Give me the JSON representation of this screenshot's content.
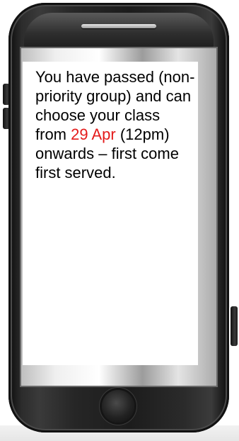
{
  "message": {
    "part1": "You have passed (non-priority group) and can choose your class from ",
    "date": "29 Apr",
    "part2": " (12pm) onwards – first come first served."
  },
  "colors": {
    "text": "#000000",
    "highlight": "#e41b1b",
    "screen": "#ffffff",
    "device_body": "#1c1c1c"
  },
  "icons": {
    "speaker": "speaker-grille-icon",
    "home": "home-button-icon"
  }
}
